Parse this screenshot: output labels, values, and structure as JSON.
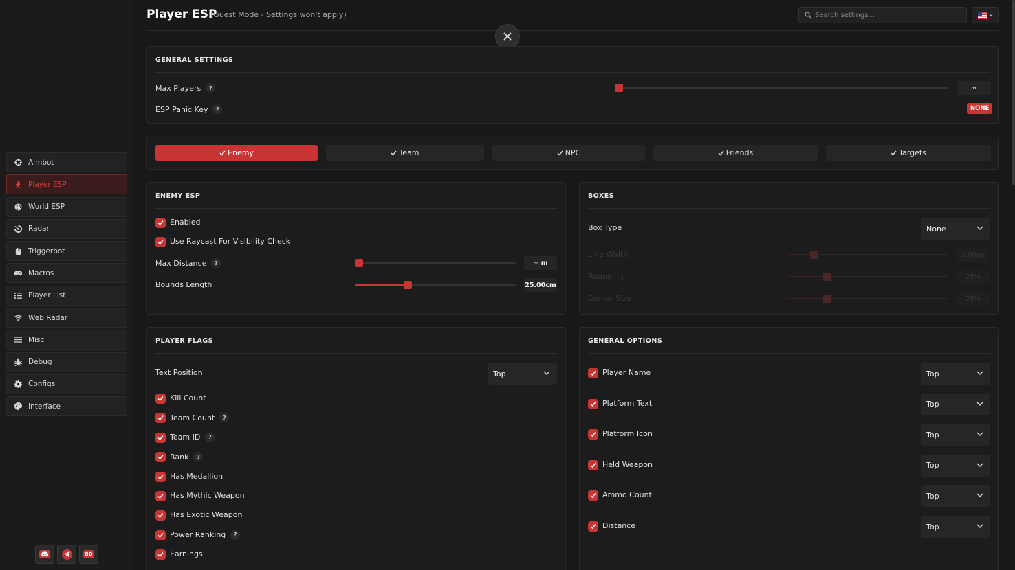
{
  "header": {
    "title": "Player ESP",
    "subtitle": "(Guest Mode - Settings won't apply)",
    "search_placeholder": "Search settings..."
  },
  "colors": {
    "accent": "#c93434",
    "background": "#181818",
    "panel": "#1c1c1c"
  },
  "sidebar": {
    "items": [
      {
        "label": "Aimbot",
        "icon": "crosshair-icon"
      },
      {
        "label": "Player ESP",
        "icon": "person-icon",
        "active": true
      },
      {
        "label": "World ESP",
        "icon": "globe-icon"
      },
      {
        "label": "Radar",
        "icon": "radar-icon"
      },
      {
        "label": "Triggerbot",
        "icon": "hand-icon"
      },
      {
        "label": "Macros",
        "icon": "gamepad-icon"
      },
      {
        "label": "Player List",
        "icon": "list-icon"
      },
      {
        "label": "Web Radar",
        "icon": "wifi-icon"
      },
      {
        "label": "Misc",
        "icon": "menu-icon"
      },
      {
        "label": "Debug",
        "icon": "bug-icon"
      },
      {
        "label": "Configs",
        "icon": "gear-icon"
      },
      {
        "label": "Interface",
        "icon": "palette-icon"
      }
    ],
    "social": [
      "discord-icon",
      "telegram-icon",
      "bd-icon"
    ],
    "social_bd_text": "BD"
  },
  "general_settings": {
    "title": "GENERAL SETTINGS",
    "max_players_label": "Max Players",
    "max_players_value": "∞",
    "max_players_level": 0,
    "panic_key_label": "ESP Panic Key",
    "panic_key_value": "NONE"
  },
  "tabs": [
    {
      "label": "Enemy",
      "active": true
    },
    {
      "label": "Team"
    },
    {
      "label": "NPC"
    },
    {
      "label": "Friends"
    },
    {
      "label": "Targets"
    }
  ],
  "enemy_esp": {
    "title": "ENEMY ESP",
    "enabled_label": "Enabled",
    "raycast_label": "Use Raycast For Visibility Check",
    "max_distance_label": "Max Distance",
    "max_distance_value": "∞ m",
    "max_distance_level": 0,
    "bounds_label": "Bounds Length",
    "bounds_value": "25.00cm",
    "bounds_level": 0.33
  },
  "boxes": {
    "title": "BOXES",
    "box_type_label": "Box Type",
    "box_type_value": "None",
    "line_width_label": "Line Width",
    "line_width_value": "2.00px",
    "line_width_level": 0.17,
    "rounding_label": "Rounding",
    "rounding_value": "25%",
    "rounding_level": 0.25,
    "corner_label": "Corner Size",
    "corner_value": "25%",
    "corner_level": 0.25
  },
  "player_flags": {
    "title": "PLAYER FLAGS",
    "text_position_label": "Text Position",
    "text_position_value": "Top",
    "items": [
      {
        "label": "Kill Count",
        "help": false
      },
      {
        "label": "Team Count",
        "help": true
      },
      {
        "label": "Team ID",
        "help": true
      },
      {
        "label": "Rank",
        "help": true
      },
      {
        "label": "Has Medallion",
        "help": false
      },
      {
        "label": "Has Mythic Weapon",
        "help": false
      },
      {
        "label": "Has Exotic Weapon",
        "help": false
      },
      {
        "label": "Power Ranking",
        "help": true
      },
      {
        "label": "Earnings",
        "help": false
      }
    ],
    "help_text": "?"
  },
  "general_options": {
    "title": "GENERAL OPTIONS",
    "items": [
      {
        "label": "Player Name",
        "value": "Top"
      },
      {
        "label": "Platform Text",
        "value": "Top"
      },
      {
        "label": "Platform Icon",
        "value": "Top"
      },
      {
        "label": "Held Weapon",
        "value": "Top"
      },
      {
        "label": "Ammo Count",
        "value": "Top"
      },
      {
        "label": "Distance",
        "value": "Top"
      }
    ]
  }
}
